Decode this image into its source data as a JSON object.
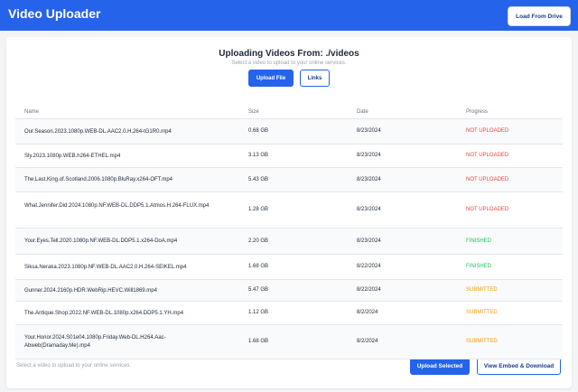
{
  "app": {
    "title": "Video Uploader",
    "load_drive_label": "Load From Drive"
  },
  "header": {
    "title": "Uploading Videos From: ./videos",
    "subtitle": "Select a video to upload to your online services.",
    "upload_file_label": "Upload File",
    "links_label": "Links"
  },
  "table": {
    "columns": [
      "Name",
      "Size",
      "Date",
      "Progress"
    ],
    "rows": [
      {
        "name": "Our.Season.2023.1080p.WEB-DL.AAC2.0.H.264-tG1R0.mp4",
        "size": "0.68 GB",
        "date": "8/23/2024",
        "progress": "NOT UPLOADED",
        "status": "not-uploaded"
      },
      {
        "name": "Sly.2023.1080p.WEB.h264-ETHEL.mp4",
        "size": "3.13 GB",
        "date": "8/23/2024",
        "progress": "NOT UPLOADED",
        "status": "not-uploaded"
      },
      {
        "name": "The.Last.King.of.Scotland.2006.1080p.BluRay.x264-OFT.mp4",
        "size": "5.43 GB",
        "date": "8/23/2024",
        "progress": "NOT UPLOADED",
        "status": "not-uploaded"
      },
      {
        "name": "What.Jennifer.Did.2024.1080p.NF.WEB-DL.DDP5.1.Atmos.H.264-FLUX.mp4",
        "size": "1.28 GB",
        "date": "8/23/2024",
        "progress": "NOT UPLOADED",
        "status": "not-uploaded"
      },
      {
        "name": "Your.Eyes.Tell.2020.1080p.NF.WEB-DL.DDP5.1.x264-DoA.mp4",
        "size": "2.20 GB",
        "date": "8/23/2024",
        "progress": "FINISHED",
        "status": "finished"
      },
      {
        "name": "Siksa.Neraka.2023.1080p.NF.WEB-DL.AAC2.0.H.264-SEIKEL.mp4",
        "size": "1.68 GB",
        "date": "8/22/2024",
        "progress": "FINISHED",
        "status": "finished"
      },
      {
        "name": "Gunner.2024.2160p.HDR.WebRip.HEVC.Will1869.mp4",
        "size": "5.47 GB",
        "date": "8/22/2024",
        "progress": "SUBMITTED",
        "status": "submitted"
      },
      {
        "name": "The.Antique.Shop.2022.NF.WEB-DL.1080p.x264.DDP5.1.YH.mp4",
        "size": "1.12 GB",
        "date": "8/2/2024",
        "progress": "SUBMITTED",
        "status": "submitted"
      },
      {
        "name": "Your.Honor.2024.S01e04.1080p.Friday.Web-DL.H264.Aac-Abweb(Dramaday.Me).mp4",
        "size": "1.68 GB",
        "date": "8/2/2024",
        "progress": "SUBMITTED",
        "status": "submitted"
      }
    ]
  },
  "footer": {
    "hint": "Select a video to upload to your online services.",
    "upload_selected_label": "Upload Selected",
    "view_embed_label": "View Embed & Download"
  },
  "colors": {
    "accent": "#2563eb",
    "not_uploaded": "#ef4444",
    "finished": "#22c55e",
    "submitted": "#f59e0b"
  }
}
